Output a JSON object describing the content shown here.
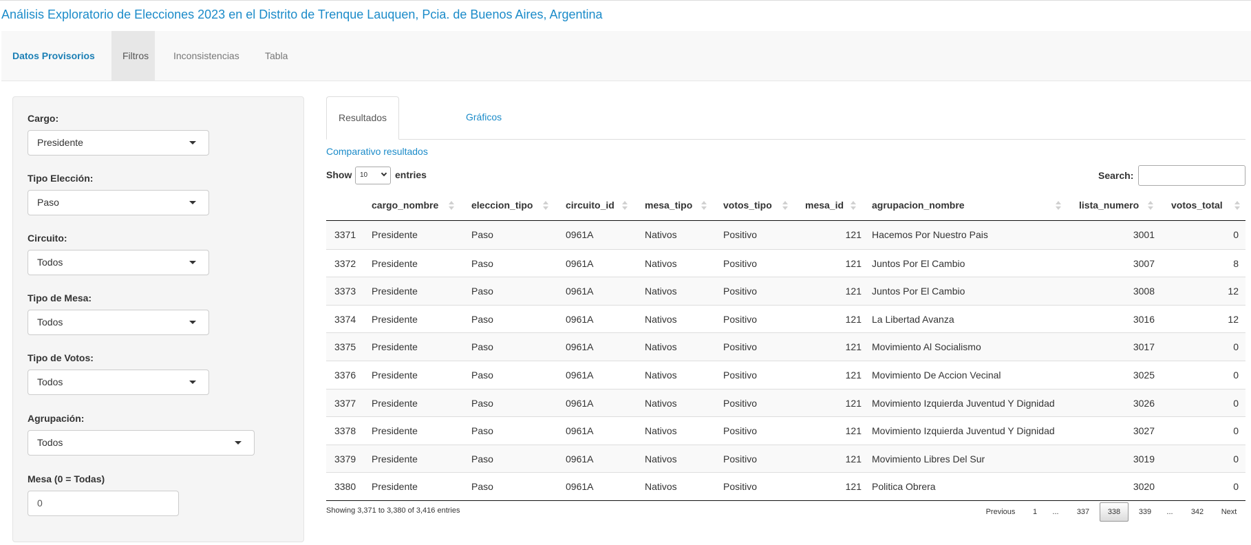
{
  "app": {
    "title": "Análisis Exploratorio de Elecciones 2023 en el Distrito de Trenque Lauquen, Pcia. de Buenos Aires, Argentina"
  },
  "navbar": {
    "items": [
      {
        "label": "Datos Provisorios"
      },
      {
        "label": "Filtros"
      },
      {
        "label": "Inconsistencias"
      },
      {
        "label": "Tabla"
      }
    ]
  },
  "sidebar": {
    "filters": [
      {
        "label": "Cargo:",
        "value": "Presidente"
      },
      {
        "label": "Tipo Elección:",
        "value": "Paso"
      },
      {
        "label": "Circuito:",
        "value": "Todos"
      },
      {
        "label": "Tipo de Mesa:",
        "value": "Todos"
      },
      {
        "label": "Tipo de Votos:",
        "value": "Todos"
      },
      {
        "label": "Agrupación:",
        "value": "Todos"
      }
    ],
    "mesa": {
      "label": "Mesa (0 = Todas)",
      "value": "0"
    }
  },
  "main": {
    "tabs": [
      {
        "label": "Resultados"
      },
      {
        "label": "Gráficos"
      }
    ],
    "section_link": "Comparativo resultados",
    "length": {
      "prefix": "Show",
      "value": "10",
      "suffix": "entries"
    },
    "search": {
      "label": "Search:",
      "value": ""
    },
    "table": {
      "columns": [
        "",
        "cargo_nombre",
        "eleccion_tipo",
        "circuito_id",
        "mesa_tipo",
        "votos_tipo",
        "mesa_id",
        "agrupacion_nombre",
        "lista_numero",
        "votos_total"
      ],
      "rows": [
        [
          "3371",
          "Presidente",
          "Paso",
          "0961A",
          "Nativos",
          "Positivo",
          "121",
          "Hacemos Por Nuestro Pais",
          "3001",
          "0"
        ],
        [
          "3372",
          "Presidente",
          "Paso",
          "0961A",
          "Nativos",
          "Positivo",
          "121",
          "Juntos Por El Cambio",
          "3007",
          "8"
        ],
        [
          "3373",
          "Presidente",
          "Paso",
          "0961A",
          "Nativos",
          "Positivo",
          "121",
          "Juntos Por El Cambio",
          "3008",
          "12"
        ],
        [
          "3374",
          "Presidente",
          "Paso",
          "0961A",
          "Nativos",
          "Positivo",
          "121",
          "La Libertad Avanza",
          "3016",
          "12"
        ],
        [
          "3375",
          "Presidente",
          "Paso",
          "0961A",
          "Nativos",
          "Positivo",
          "121",
          "Movimiento Al Socialismo",
          "3017",
          "0"
        ],
        [
          "3376",
          "Presidente",
          "Paso",
          "0961A",
          "Nativos",
          "Positivo",
          "121",
          "Movimiento De Accion Vecinal",
          "3025",
          "0"
        ],
        [
          "3377",
          "Presidente",
          "Paso",
          "0961A",
          "Nativos",
          "Positivo",
          "121",
          "Movimiento Izquierda Juventud Y Dignidad",
          "3026",
          "0"
        ],
        [
          "3378",
          "Presidente",
          "Paso",
          "0961A",
          "Nativos",
          "Positivo",
          "121",
          "Movimiento Izquierda Juventud Y Dignidad",
          "3027",
          "0"
        ],
        [
          "3379",
          "Presidente",
          "Paso",
          "0961A",
          "Nativos",
          "Positivo",
          "121",
          "Movimiento Libres Del Sur",
          "3019",
          "0"
        ],
        [
          "3380",
          "Presidente",
          "Paso",
          "0961A",
          "Nativos",
          "Positivo",
          "121",
          "Politica Obrera",
          "3020",
          "0"
        ]
      ]
    },
    "info": "Showing 3,371 to 3,380 of 3,416 entries",
    "pagination": [
      "Previous",
      "1",
      "...",
      "337",
      "338",
      "339",
      "...",
      "342",
      "Next"
    ]
  },
  "colors": {
    "accent": "#1b8bc9",
    "navbar_bg": "#f8f8f8",
    "sidebar_bg": "#f5f5f5",
    "row_stripe": "#f9f9f9"
  }
}
